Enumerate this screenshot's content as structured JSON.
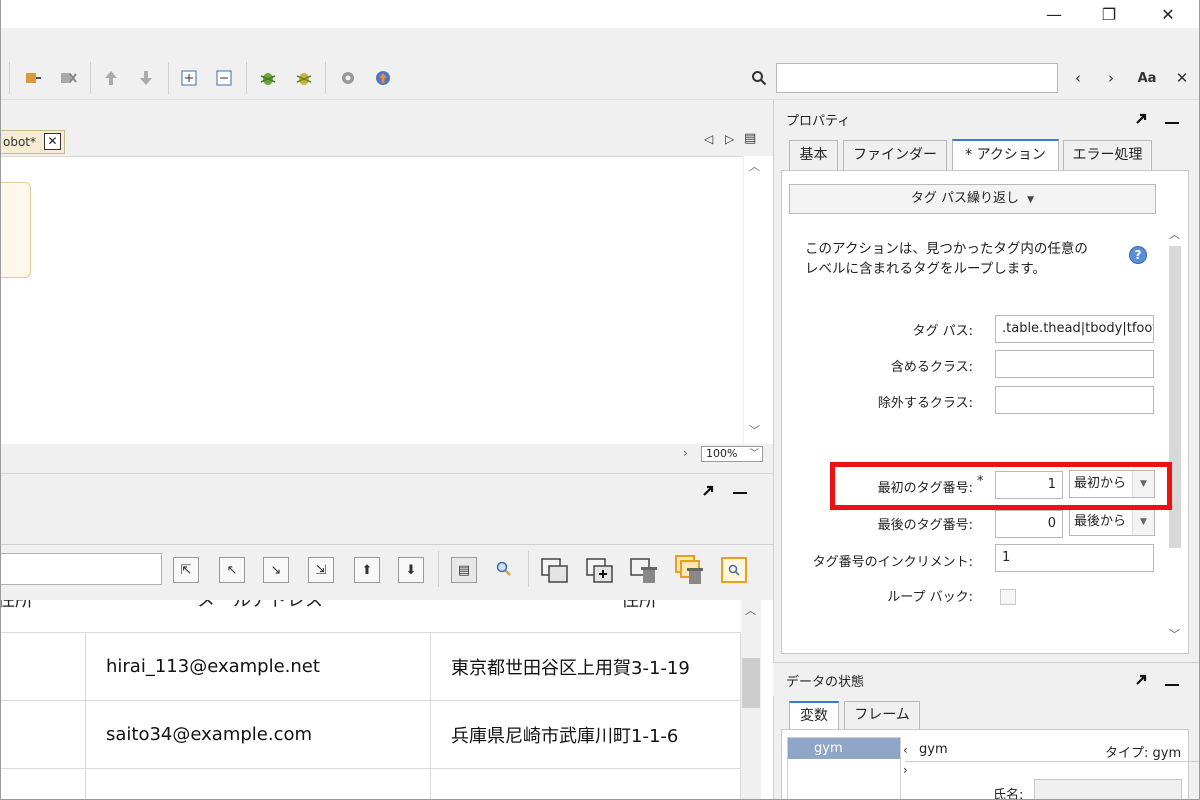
{
  "window": {
    "minimize_glyph": "—",
    "maximize_glyph": "❐",
    "close_glyph": "✕"
  },
  "toolbar": {
    "search_value": "",
    "prev_glyph": "‹",
    "next_glyph": "›",
    "match_case_label": "Aa",
    "close_search_glyph": "✕"
  },
  "editor": {
    "tab_label": "obot*",
    "tab_close": "✕",
    "zoom": "100%"
  },
  "grid": {
    "header_left": "住所",
    "header_mid": "メールアドレス",
    "header_right": "住所",
    "rows": [
      {
        "email": "hirai_113@example.net",
        "address": "東京都世田谷区上用賀3-1-19"
      },
      {
        "email": "saito34@example.com",
        "address": "兵庫県尼崎市武庫川町1-1-6"
      }
    ]
  },
  "properties": {
    "title": "プロパティ",
    "tabs": [
      {
        "label": "基本"
      },
      {
        "label": "ファインダー"
      },
      {
        "label": "* アクション"
      },
      {
        "label": "エラー処理"
      }
    ],
    "action_button": "タグ パス繰り返し",
    "description_line1": "このアクションは、見つかったタグ内の任意の",
    "description_line2": "レベルに含まれるタグをループします。",
    "help_glyph": "?",
    "fields": {
      "tag_path_label": "タグ パス:",
      "tag_path_value": ".table.thead|tbody|tfoot",
      "include_class_label": "含めるクラス:",
      "include_class_value": "",
      "exclude_class_label": "除外するクラス:",
      "exclude_class_value": "",
      "first_tag_label": "最初のタグ番号:",
      "first_tag_value": "1",
      "first_tag_mode": "最初から",
      "last_tag_label": "最後のタグ番号:",
      "last_tag_value": "0",
      "last_tag_mode": "最後から",
      "increment_label": "タグ番号のインクリメント:",
      "increment_value": "1",
      "loop_back_label": "ループ バック:"
    }
  },
  "data_status": {
    "title": "データの状態",
    "tabs": [
      {
        "label": "変数"
      },
      {
        "label": "フレーム"
      }
    ],
    "selected_variable": "gym",
    "variable_name": "gym",
    "type_label": "タイプ: gym",
    "field_name_label": "氏名:"
  },
  "colors": {
    "highlight": "#ee1111",
    "active_tab_accent": "#3a78d0"
  }
}
